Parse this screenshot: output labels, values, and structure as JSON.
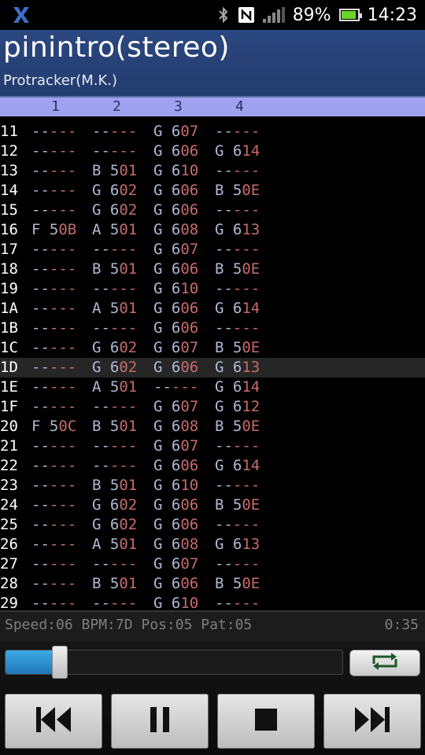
{
  "status_bar": {
    "battery_pct": "89%",
    "time": "14:23",
    "icons": [
      "app-x-icon",
      "bluetooth-icon",
      "nfc-icon",
      "signal-icon",
      "battery-icon"
    ]
  },
  "header": {
    "title": "pinintro(stereo)",
    "format": "Protracker(M.K.)"
  },
  "channels": [
    "1",
    "2",
    "3",
    "4"
  ],
  "current_row": "1D",
  "rows": [
    {
      "r": "11",
      "c": [
        "-----",
        "-----",
        "G 607",
        "-----"
      ]
    },
    {
      "r": "12",
      "c": [
        "-----",
        "-----",
        "G 606",
        "G 614"
      ]
    },
    {
      "r": "13",
      "c": [
        "-----",
        "B 501",
        "G 610",
        "-----"
      ]
    },
    {
      "r": "14",
      "c": [
        "-----",
        "G 602",
        "G 606",
        "B 50E"
      ]
    },
    {
      "r": "15",
      "c": [
        "-----",
        "G 602",
        "G 606",
        "-----"
      ]
    },
    {
      "r": "16",
      "c": [
        "F 50B",
        "A 501",
        "G 608",
        "G 613"
      ]
    },
    {
      "r": "17",
      "c": [
        "-----",
        "-----",
        "G 607",
        "-----"
      ]
    },
    {
      "r": "18",
      "c": [
        "-----",
        "B 501",
        "G 606",
        "B 50E"
      ]
    },
    {
      "r": "19",
      "c": [
        "-----",
        "-----",
        "G 610",
        "-----"
      ]
    },
    {
      "r": "1A",
      "c": [
        "-----",
        "A 501",
        "G 606",
        "G 614"
      ]
    },
    {
      "r": "1B",
      "c": [
        "-----",
        "-----",
        "G 606",
        "-----"
      ]
    },
    {
      "r": "1C",
      "c": [
        "-----",
        "G 602",
        "G 607",
        "B 50E"
      ]
    },
    {
      "r": "1D",
      "c": [
        "-----",
        "G 602",
        "G 606",
        "G 613"
      ]
    },
    {
      "r": "1E",
      "c": [
        "-----",
        "A 501",
        "-----",
        "G 614"
      ]
    },
    {
      "r": "1F",
      "c": [
        "-----",
        "-----",
        "G 607",
        "G 612"
      ]
    },
    {
      "r": "20",
      "c": [
        "F 50C",
        "B 501",
        "G 608",
        "B 50E"
      ]
    },
    {
      "r": "21",
      "c": [
        "-----",
        "-----",
        "G 607",
        "-----"
      ]
    },
    {
      "r": "22",
      "c": [
        "-----",
        "-----",
        "G 606",
        "G 614"
      ]
    },
    {
      "r": "23",
      "c": [
        "-----",
        "B 501",
        "G 610",
        "-----"
      ]
    },
    {
      "r": "24",
      "c": [
        "-----",
        "G 602",
        "G 606",
        "B 50E"
      ]
    },
    {
      "r": "25",
      "c": [
        "-----",
        "G 602",
        "G 606",
        "-----"
      ]
    },
    {
      "r": "26",
      "c": [
        "-----",
        "A 501",
        "G 608",
        "G 613"
      ]
    },
    {
      "r": "27",
      "c": [
        "-----",
        "-----",
        "G 607",
        "-----"
      ]
    },
    {
      "r": "28",
      "c": [
        "-----",
        "B 501",
        "G 606",
        "B 50E"
      ]
    },
    {
      "r": "29",
      "c": [
        "-----",
        "-----",
        "G 610",
        "-----"
      ]
    }
  ],
  "info": {
    "text": "Speed:06 BPM:7D Pos:05 Pat:05",
    "elapsed": "0:35"
  },
  "seek": {
    "progress": 0.16
  },
  "controls": {
    "repeat": "repeat-icon",
    "prev": "skip-previous-icon",
    "pause": "pause-icon",
    "stop": "stop-icon",
    "next": "skip-next-icon"
  },
  "colors": {
    "header_bg": "#233c6e",
    "channel_bar": "#9ea2ef",
    "note": "#b1b8d2",
    "effect": "#c86a6a",
    "seek_fill": "#2f8fd0"
  }
}
